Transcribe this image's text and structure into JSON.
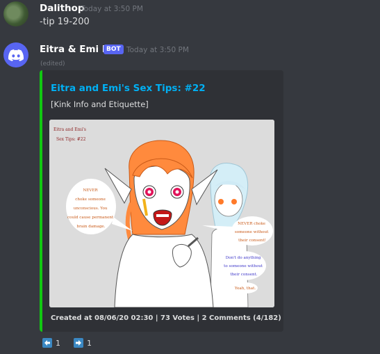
{
  "messages": [
    {
      "username": "Dalithop",
      "timestamp": "Today at 3:50 PM",
      "content": "-tip 19-200"
    },
    {
      "username": "Eitra & Emi bot",
      "badge": "BOT",
      "timestamp": "Today at 3:50 PM",
      "edited": "(edited)"
    }
  ],
  "embed": {
    "color": "#11c911",
    "title": "Eitra and Emi's Sex Tips: #22",
    "description": "[Kink Info and Etiquette]",
    "image": {
      "corner_title_1": "Eitra and Emi's",
      "corner_title_2": "Sex Tips: #22",
      "bubble_left": [
        "NEVER",
        "choke someone",
        "unconscious. You",
        "could cause permanent",
        "brain damage."
      ],
      "bubble_right_1": [
        "NEVER choke",
        "someone without",
        "their consent!"
      ],
      "bubble_right_2": [
        "Don't do anything",
        "to someone without",
        "their consent."
      ],
      "bubble_right_3": "Yeah, that."
    },
    "footer": "Created at 08/06/20 02:30 | 73 Votes | 2 Comments (4/182)"
  },
  "reactions": [
    {
      "icon": "left-arrow-icon",
      "count": "1"
    },
    {
      "icon": "right-arrow-icon",
      "count": "1"
    }
  ]
}
